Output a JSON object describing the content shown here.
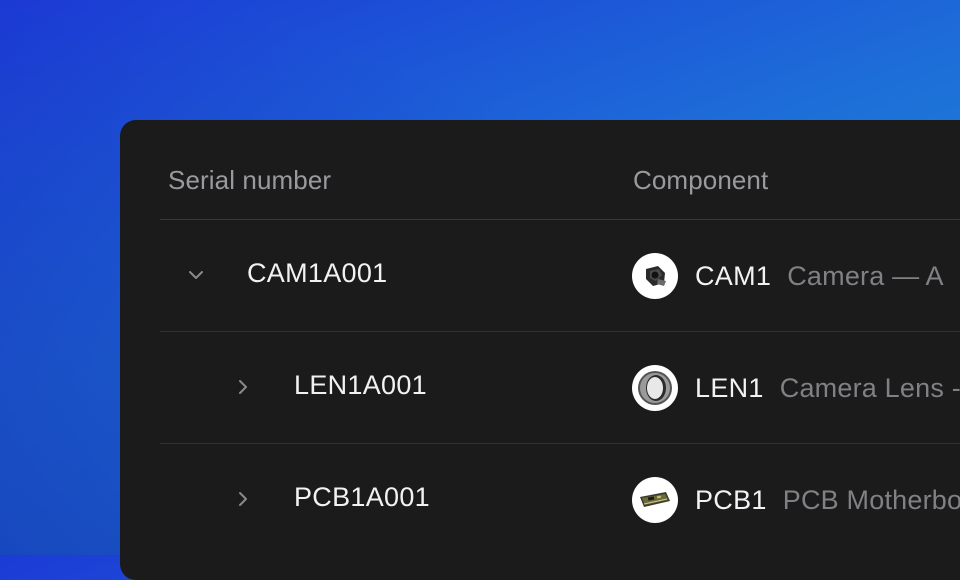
{
  "table": {
    "headers": {
      "serial": "Serial number",
      "component": "Component"
    },
    "rows": [
      {
        "serial": "CAM1A001",
        "expanded": true,
        "level": 0,
        "component_code": "CAM1",
        "component_desc": "Camera — A",
        "thumb_icon": "camera-thumbnail"
      },
      {
        "serial": "LEN1A001",
        "expanded": false,
        "level": 1,
        "component_code": "LEN1",
        "component_desc": "Camera Lens -",
        "thumb_icon": "lens-thumbnail"
      },
      {
        "serial": "PCB1A001",
        "expanded": false,
        "level": 1,
        "component_code": "PCB1",
        "component_desc": "PCB Motherbo",
        "thumb_icon": "pcb-thumbnail"
      }
    ]
  },
  "colors": {
    "panel_bg": "#1b1b1c",
    "text_primary": "#f2f2f4",
    "text_secondary": "#808085",
    "header_text": "#9a9a9e"
  }
}
